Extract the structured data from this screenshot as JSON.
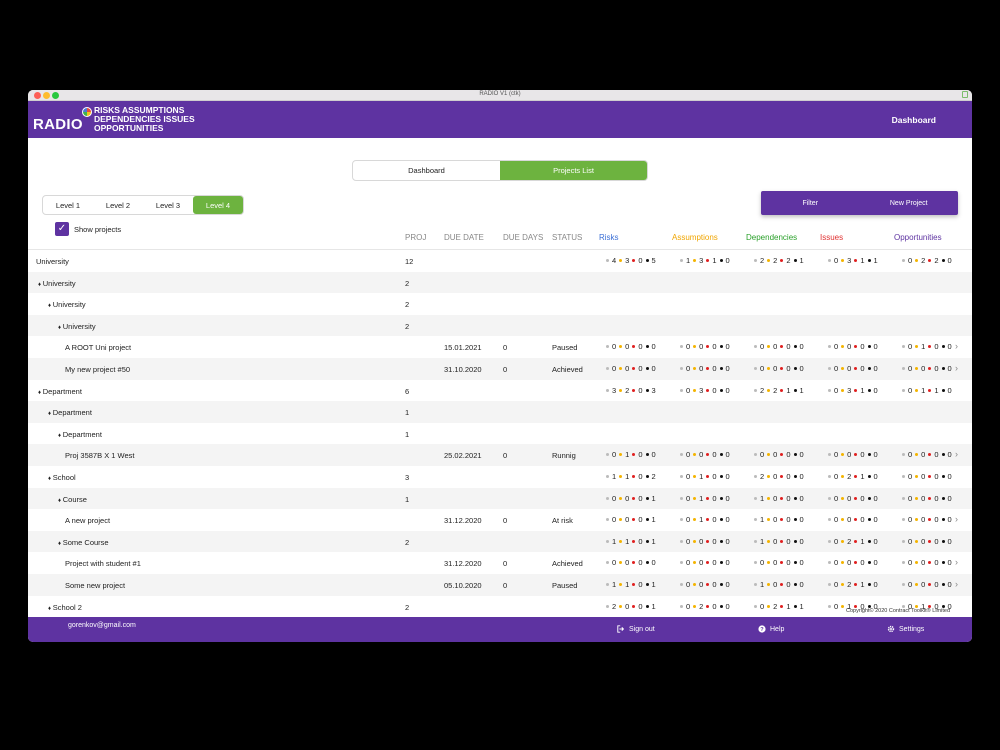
{
  "window": {
    "title": "RADIO V1 (ctk)"
  },
  "header": {
    "logo": "RADIO",
    "logo_lines": [
      "RISKS  ASSUMPTIONS",
      "DEPENDENCIES  ISSUES",
      "OPPORTUNITIES"
    ],
    "title": "Dashboard"
  },
  "tabs": [
    "Dashboard",
    "Projects List"
  ],
  "active_tab": "Projects List",
  "levels": [
    "Level 1",
    "Level 2",
    "Level 3",
    "Level 4"
  ],
  "show_projects_label": "Show projects",
  "filter_label": "Filter",
  "new_project_label": "New Project",
  "columns": {
    "proj": "PROJ",
    "due_date": "DUE DATE",
    "due_days": "DUE DAYS",
    "status": "STATUS",
    "risks": "Risks",
    "assumptions": "Assumptions",
    "dependencies": "Dependencies",
    "issues": "Issues",
    "opportunities": "Opportunities"
  },
  "colors": {
    "brand": "#5e33a1",
    "accent": "#6db33f",
    "risks": "#3b6fd6",
    "assumptions": "#f0a500",
    "dependencies": "#2aa02a",
    "issues": "#e03030",
    "opportunities": "#5e33a1"
  },
  "rows": [
    {
      "level": 0,
      "name": "University",
      "proj": "12",
      "due_date": "",
      "due_days": "",
      "status": "",
      "stats": [
        [
          "4",
          "3",
          "0",
          "5"
        ],
        [
          "1",
          "3",
          "1",
          "0"
        ],
        [
          "2",
          "2",
          "2",
          "1"
        ],
        [
          "0",
          "3",
          "1",
          "1"
        ],
        [
          "0",
          "2",
          "2",
          "0"
        ]
      ]
    },
    {
      "level": 1,
      "name": "University",
      "proj": "2",
      "due_date": "",
      "due_days": "",
      "status": "",
      "stats": []
    },
    {
      "level": 2,
      "name": "University",
      "proj": "2",
      "due_date": "",
      "due_days": "",
      "status": "",
      "stats": []
    },
    {
      "level": 3,
      "name": "University",
      "proj": "2",
      "due_date": "",
      "due_days": "",
      "status": "",
      "stats": []
    },
    {
      "level": 4,
      "name": "A ROOT Uni project",
      "proj": "",
      "due_date": "15.01.2021",
      "due_days": "0",
      "status": "Paused",
      "chevron": true,
      "stats": [
        [
          "0",
          "0",
          "0",
          "0"
        ],
        [
          "0",
          "0",
          "0",
          "0"
        ],
        [
          "0",
          "0",
          "0",
          "0"
        ],
        [
          "0",
          "0",
          "0",
          "0"
        ],
        [
          "0",
          "1",
          "0",
          "0"
        ]
      ]
    },
    {
      "level": 4,
      "name": "My new project #50",
      "proj": "",
      "due_date": "31.10.2020",
      "due_days": "0",
      "status": "Achieved",
      "chevron": true,
      "stats": [
        [
          "0",
          "0",
          "0",
          "0"
        ],
        [
          "0",
          "0",
          "0",
          "0"
        ],
        [
          "0",
          "0",
          "0",
          "0"
        ],
        [
          "0",
          "0",
          "0",
          "0"
        ],
        [
          "0",
          "0",
          "0",
          "0"
        ]
      ]
    },
    {
      "level": 1,
      "name": "Department",
      "proj": "6",
      "due_date": "",
      "due_days": "",
      "status": "",
      "stats": [
        [
          "3",
          "2",
          "0",
          "3"
        ],
        [
          "0",
          "3",
          "0",
          "0"
        ],
        [
          "2",
          "2",
          "1",
          "1"
        ],
        [
          "0",
          "3",
          "1",
          "0"
        ],
        [
          "0",
          "1",
          "1",
          "0"
        ]
      ]
    },
    {
      "level": 2,
      "name": "Department",
      "proj": "1",
      "due_date": "",
      "due_days": "",
      "status": "",
      "stats": []
    },
    {
      "level": 3,
      "name": "Department",
      "proj": "1",
      "due_date": "",
      "due_days": "",
      "status": "",
      "stats": []
    },
    {
      "level": 4,
      "name": "Proj 3587B X 1 West",
      "proj": "",
      "due_date": "25.02.2021",
      "due_days": "0",
      "status": "Runnig",
      "chevron": true,
      "stats": [
        [
          "0",
          "1",
          "0",
          "0"
        ],
        [
          "0",
          "0",
          "0",
          "0"
        ],
        [
          "0",
          "0",
          "0",
          "0"
        ],
        [
          "0",
          "0",
          "0",
          "0"
        ],
        [
          "0",
          "0",
          "0",
          "0"
        ]
      ]
    },
    {
      "level": 2,
      "name": "School",
      "proj": "3",
      "due_date": "",
      "due_days": "",
      "status": "",
      "stats": [
        [
          "1",
          "1",
          "0",
          "2"
        ],
        [
          "0",
          "1",
          "0",
          "0"
        ],
        [
          "2",
          "0",
          "0",
          "0"
        ],
        [
          "0",
          "2",
          "1",
          "0"
        ],
        [
          "0",
          "0",
          "0",
          "0"
        ]
      ]
    },
    {
      "level": 3,
      "name": "Course",
      "proj": "1",
      "due_date": "",
      "due_days": "",
      "status": "",
      "stats": [
        [
          "0",
          "0",
          "0",
          "1"
        ],
        [
          "0",
          "1",
          "0",
          "0"
        ],
        [
          "1",
          "0",
          "0",
          "0"
        ],
        [
          "0",
          "0",
          "0",
          "0"
        ],
        [
          "0",
          "0",
          "0",
          "0"
        ]
      ]
    },
    {
      "level": 4,
      "name": "A new project",
      "proj": "",
      "due_date": "31.12.2020",
      "due_days": "0",
      "status": "At risk",
      "chevron": true,
      "stats": [
        [
          "0",
          "0",
          "0",
          "1"
        ],
        [
          "0",
          "1",
          "0",
          "0"
        ],
        [
          "1",
          "0",
          "0",
          "0"
        ],
        [
          "0",
          "0",
          "0",
          "0"
        ],
        [
          "0",
          "0",
          "0",
          "0"
        ]
      ]
    },
    {
      "level": 3,
      "name": "Some Course",
      "proj": "2",
      "due_date": "",
      "due_days": "",
      "status": "",
      "stats": [
        [
          "1",
          "1",
          "0",
          "1"
        ],
        [
          "0",
          "0",
          "0",
          "0"
        ],
        [
          "1",
          "0",
          "0",
          "0"
        ],
        [
          "0",
          "2",
          "1",
          "0"
        ],
        [
          "0",
          "0",
          "0",
          "0"
        ]
      ]
    },
    {
      "level": 4,
      "name": "Project with student #1",
      "proj": "",
      "due_date": "31.12.2020",
      "due_days": "0",
      "status": "Achieved",
      "chevron": true,
      "stats": [
        [
          "0",
          "0",
          "0",
          "0"
        ],
        [
          "0",
          "0",
          "0",
          "0"
        ],
        [
          "0",
          "0",
          "0",
          "0"
        ],
        [
          "0",
          "0",
          "0",
          "0"
        ],
        [
          "0",
          "0",
          "0",
          "0"
        ]
      ]
    },
    {
      "level": 4,
      "name": "Some new project",
      "proj": "",
      "due_date": "05.10.2020",
      "due_days": "0",
      "status": "Paused",
      "chevron": true,
      "stats": [
        [
          "1",
          "1",
          "0",
          "1"
        ],
        [
          "0",
          "0",
          "0",
          "0"
        ],
        [
          "1",
          "0",
          "0",
          "0"
        ],
        [
          "0",
          "2",
          "1",
          "0"
        ],
        [
          "0",
          "0",
          "0",
          "0"
        ]
      ]
    },
    {
      "level": 2,
      "name": "School 2",
      "proj": "2",
      "due_date": "",
      "due_days": "",
      "status": "",
      "stats": [
        [
          "2",
          "0",
          "0",
          "1"
        ],
        [
          "0",
          "2",
          "0",
          "0"
        ],
        [
          "0",
          "2",
          "1",
          "1"
        ],
        [
          "0",
          "1",
          "0",
          "0"
        ],
        [
          "0",
          "1",
          "0",
          "0"
        ]
      ]
    }
  ],
  "footer": {
    "email": "gorenkov@gmail.com",
    "copyright": "Copyright© 2020 Contract Toolkit® Limited",
    "sign_out": "Sign out",
    "help": "Help",
    "settings": "Settings"
  }
}
